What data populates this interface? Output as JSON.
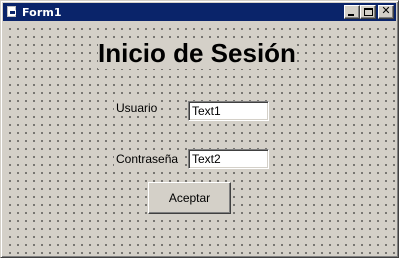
{
  "window": {
    "title": "Form1",
    "icon": "form-icon",
    "controls": {
      "minimize_icon": "minimize-icon",
      "maximize_icon": "maximize-icon",
      "close_icon": "close-icon",
      "close_glyph": "✕"
    }
  },
  "form": {
    "heading": "Inicio de Sesión",
    "username_label": "Usuario",
    "username_value": "Text1",
    "password_label": "Contraseña",
    "password_value": "Text2",
    "submit_label": "Aceptar"
  },
  "colors": {
    "titlebar": "#0a246a",
    "face": "#d4d0c8",
    "field": "#ffffff"
  }
}
